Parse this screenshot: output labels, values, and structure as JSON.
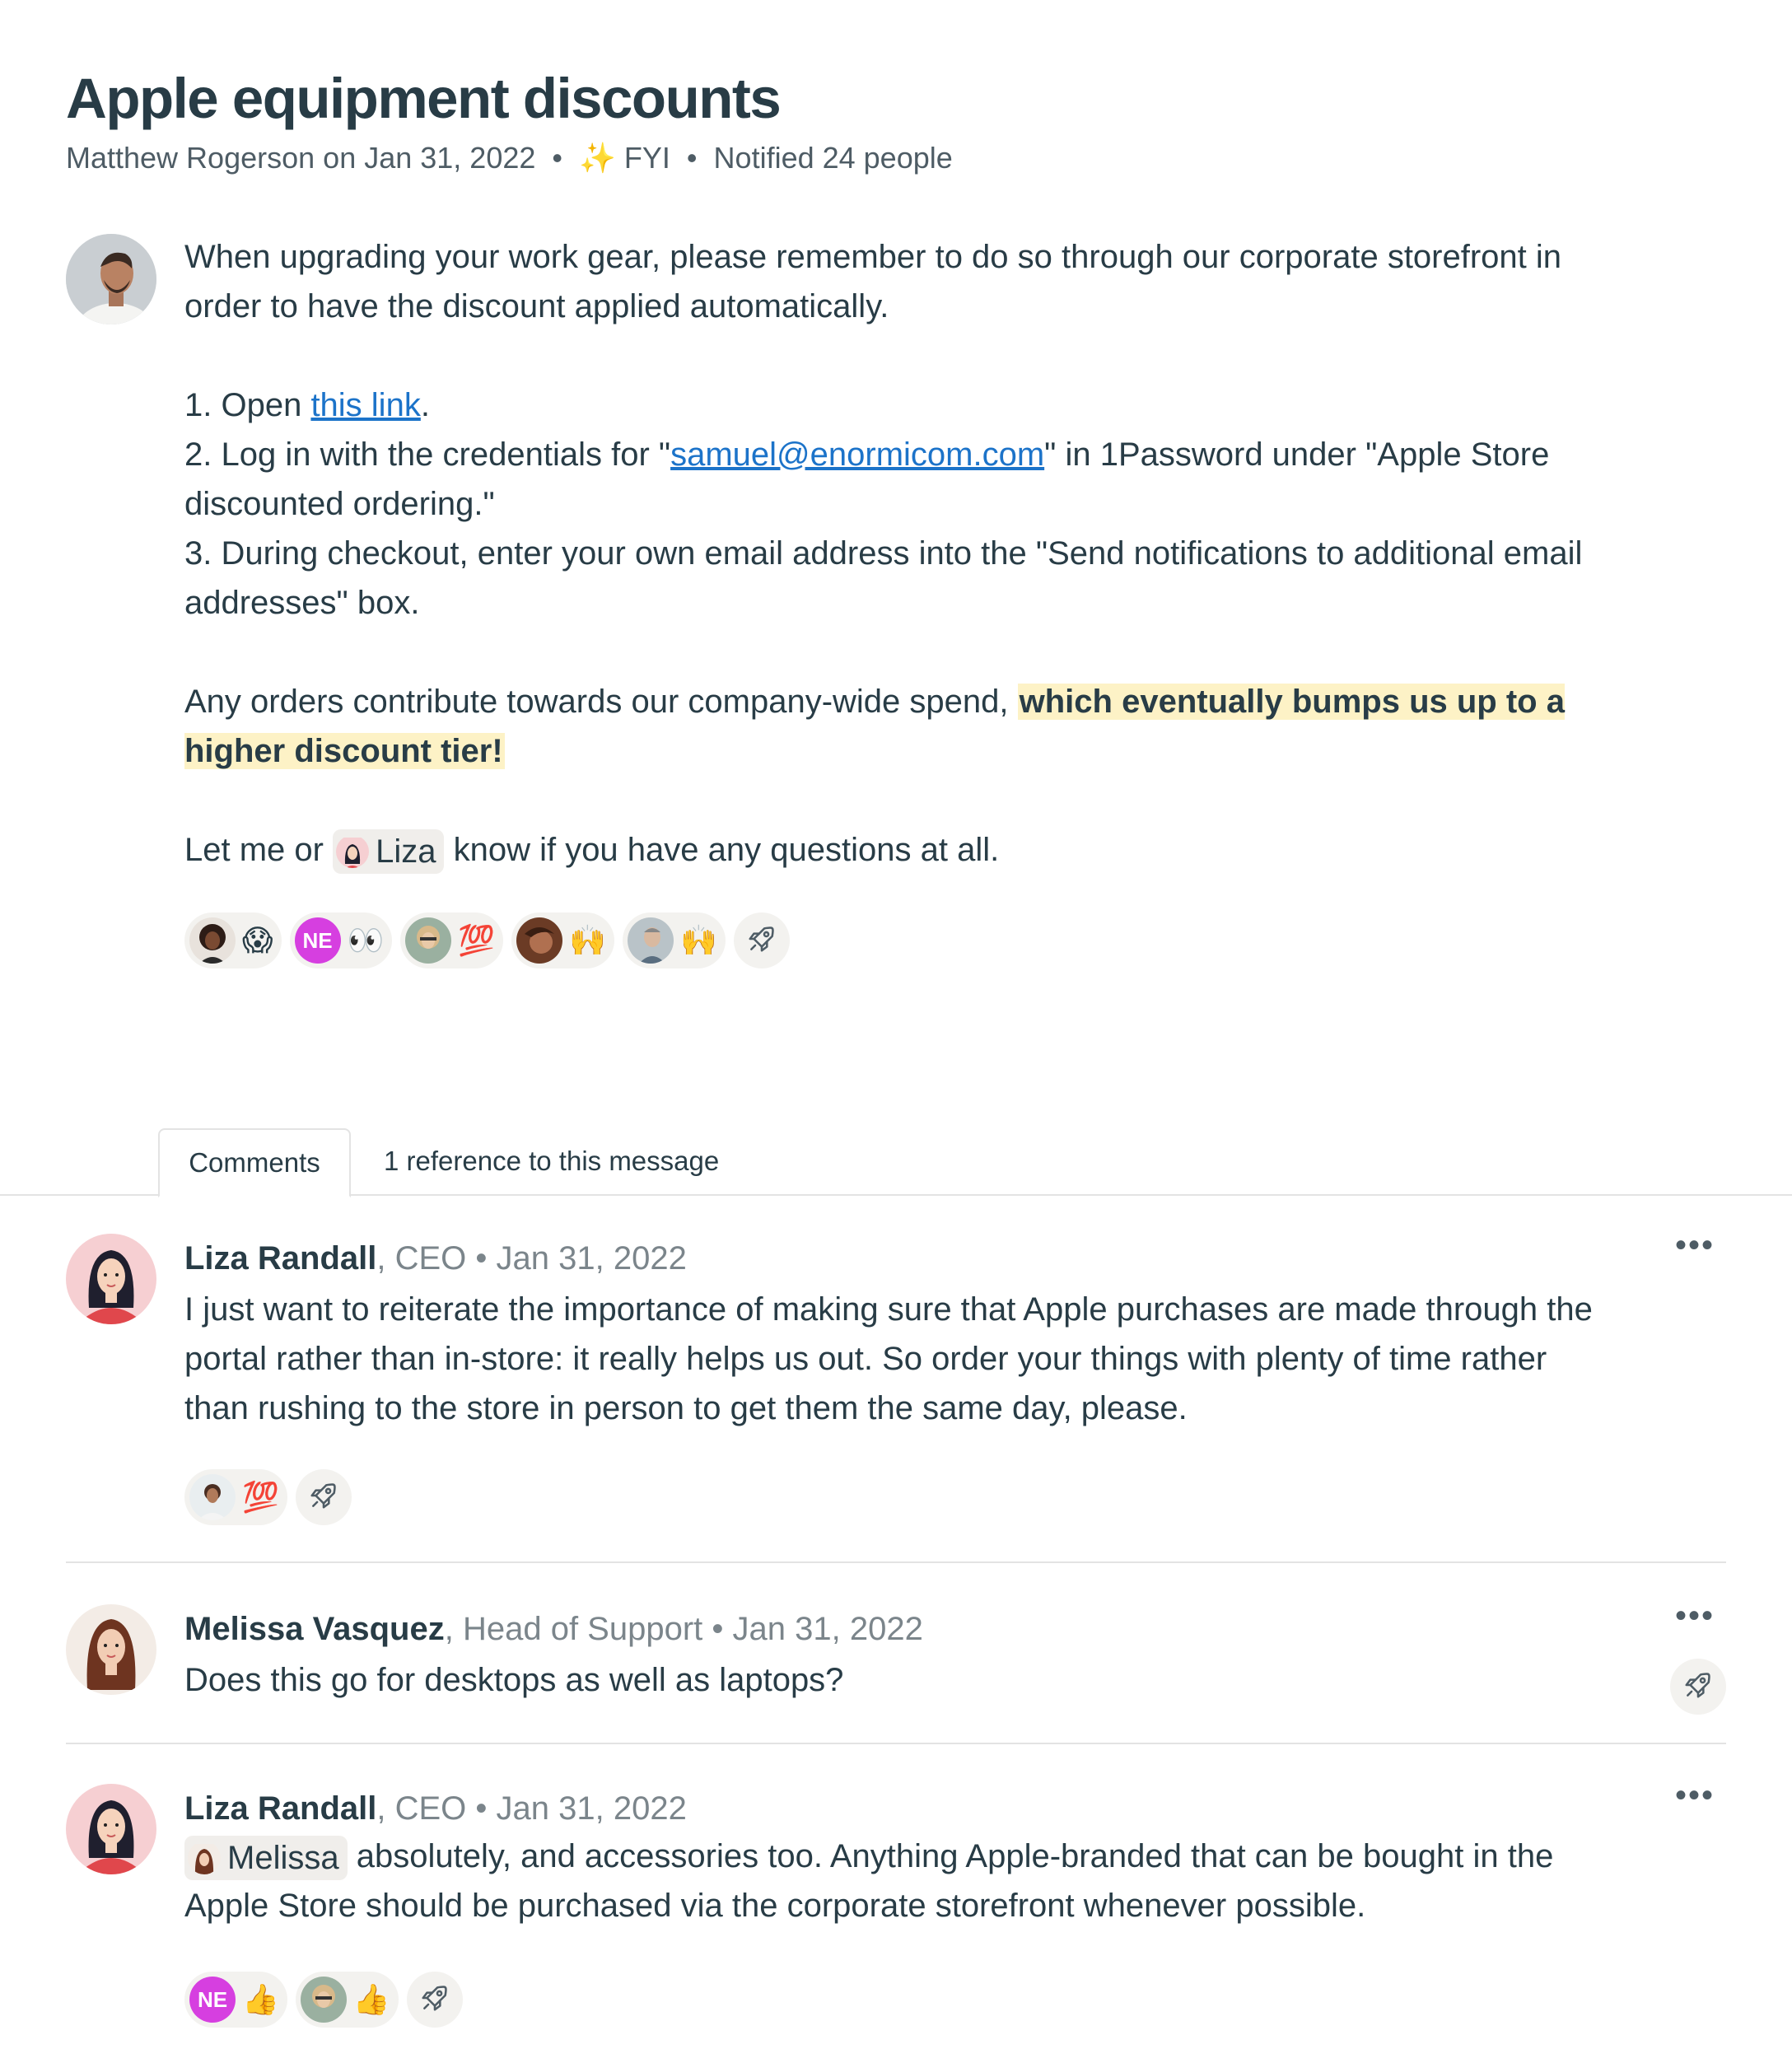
{
  "message": {
    "title": "Apple equipment discounts",
    "author": "Matthew Rogerson",
    "on_date": "on Jan 31, 2022",
    "sep": "•",
    "category_icon": "✨",
    "category": "FYI",
    "notified": "Notified 24 people",
    "para1": "When upgrading your work gear, please remember to do so through our corporate storefront in order to have the discount applied automatically.",
    "step1_pre": "1. Open ",
    "step1_link": "this link",
    "step1_post": ".",
    "step2_pre": "2. Log in with the credentials for \"",
    "step2_link": "samuel@enormicom.com",
    "step2_post": "\" in 1Password under \"Apple Store discounted ordering.\"",
    "step3": "3. During checkout, enter your own email address into the \"Send notifications to additional email addresses\" box.",
    "para3_pre": "Any orders contribute towards our company-wide spend, ",
    "para3_highlight": "which eventually bumps us up to a higher discount tier!",
    "para4_pre": "Let me or ",
    "para4_mention": "Liza",
    "para4_post": " know if you have any questions at all.",
    "reactions": [
      {
        "emoji": "😱"
      },
      {
        "initials": "NE",
        "emoji": "👀"
      },
      {
        "emoji": "💯"
      },
      {
        "emoji": "🙌"
      },
      {
        "emoji": "🙌"
      }
    ]
  },
  "tabs": {
    "comments": "Comments",
    "references": "1 reference to this message"
  },
  "comments": [
    {
      "name": "Liza Randall",
      "role": ", CEO",
      "date": " • Jan 31, 2022",
      "text": "I just want to reiterate the importance of making sure that Apple purchases are made through the portal rather than in-store: it really helps us out. So order your things with plenty of time rather than rushing to the store in person to get them the same day, please.",
      "reaction_emoji": "💯"
    },
    {
      "name": "Melissa Vasquez",
      "role": ", Head of Support",
      "date": " • Jan 31, 2022",
      "text": "Does this go for desktops as well as laptops?"
    },
    {
      "name": "Liza Randall",
      "role": ", CEO",
      "date": " • Jan 31, 2022",
      "mention": "Melissa",
      "text": " absolutely, and accessories too. Anything Apple-branded that can be bought in the Apple Store should be purchased via the corporate storefront whenever possible.",
      "reactions": [
        {
          "initials": "NE",
          "emoji": "👍"
        },
        {
          "emoji": "👍"
        }
      ]
    }
  ],
  "more_glyph": "•••",
  "colors": {
    "text": "#283c46",
    "muted": "#7b858b",
    "link": "#1c73c9",
    "highlight": "#fdf2c6",
    "ne_avatar": "#d63fe0"
  }
}
